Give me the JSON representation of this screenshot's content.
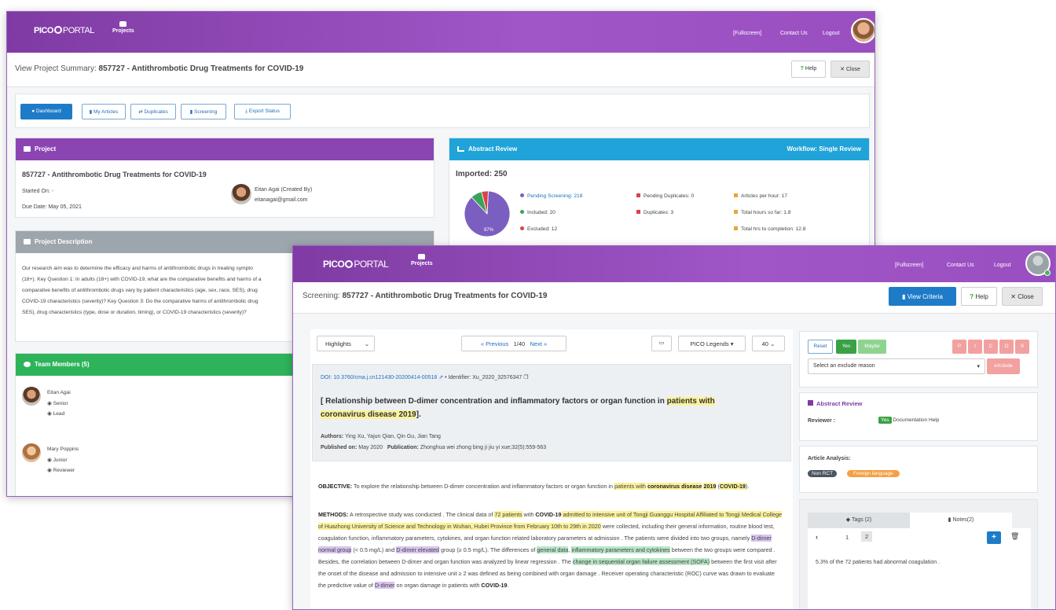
{
  "brand": {
    "logo_bold": "PICO",
    "logo_light": "PORTAL"
  },
  "navbar": {
    "projects": "Projects",
    "fullscreen": "[Fullscreen]",
    "contact": "Contact Us",
    "logout": "Logout"
  },
  "summary": {
    "title_prefix": "View Project Summary:",
    "title_main": "857727 - Antithrombotic Drug Treatments for COVID-19",
    "help": "Help",
    "close": "Close",
    "toolbar": {
      "dashboard": "Dashboard",
      "my_articles": "My Articles",
      "duplicates": "Duplicates",
      "screening": "Screening",
      "export_status": "Export Status"
    },
    "project": {
      "header": "Project",
      "title": "857727 - Antithrombotic Drug Treatments for COVID-19",
      "started_on": "Started On: -",
      "due_date": "Due Date:   May 05, 2021",
      "owner_name": "Eitan Agai (Created By)",
      "owner_email": "eitanagai@gmail.com"
    },
    "description": {
      "header": "Project Description",
      "lines": [
        "Our research aim was to determine the efficacy and harms of antithrombotic drugs in treating sympto",
        "(18+). Key Question 1: In adults (18+) with COVID-19, what are the comparative benefits and harms of a",
        "comparative benefits of antithrombotic drugs vary by patient characteristics (age, sex, race, SES), drug",
        "COVID-19 characteristics (severity)? Key Question 3: Do the comparative harms of antithrombotic drug",
        "SES), drug characteristics (type, dose or duration, timing), or COVID-19 characteristics (severity)?"
      ]
    },
    "team": {
      "header": "Team Members (5)",
      "members": [
        {
          "name": "Eitan Agai",
          "level": "Senior",
          "role": "Lead"
        },
        {
          "name": "Mary Poppins",
          "level": "Junior",
          "role": "Reviewer"
        }
      ]
    },
    "abstract_review": {
      "header": "Abstract Review",
      "workflow": "Workflow: Single Review",
      "imported": "Imported: 250",
      "pie_label": "87%",
      "pie_slices": [
        {
          "label": "Pending Screening",
          "value": 218,
          "color": "#7b5fc0"
        },
        {
          "label": "Included",
          "value": 20,
          "color": "#3aa35a"
        },
        {
          "label": "Excluded",
          "value": 12,
          "color": "#d9434a"
        }
      ],
      "col1": [
        {
          "text": "Pending Screening: 218",
          "color": "#7b5fc0"
        },
        {
          "text": "Included: 20",
          "color": "#3aa35a"
        },
        {
          "text": "Excluded: 12",
          "color": "#d9434a"
        }
      ],
      "col2": [
        {
          "text": "Pending Duplicates: 0",
          "color": "#d9434a"
        },
        {
          "text": "Duplicates: 3",
          "color": "#d9434a"
        }
      ],
      "col3": [
        {
          "text": "Articles per hour: 17",
          "color": "#f0a040"
        },
        {
          "text": "Total hours so far: 1.8",
          "color": "#f0a040"
        },
        {
          "text": "Total hrs to completion: 12.8",
          "color": "#f0a040"
        }
      ]
    }
  },
  "screening": {
    "title_prefix": "Screening:",
    "title_main": "857727 - Antithrombotic Drug Treatments for COVID-19",
    "view_criteria": "View Criteria",
    "help": "Help",
    "close": "Close",
    "highlights": "Highlights",
    "previous": "« Previous",
    "page": "1/40",
    "next": "Next »",
    "pico_legends": "PICO Legends",
    "page_size": "40",
    "doi": "DOI: 10.3760/cma.j.cn121430-20200414-00518",
    "identifier": "• Identifier: Xu_2020_32576347",
    "article_title_a": "[ Relationship between D-dimer concentration and inflammatory factors or organ function in ",
    "article_title_hl": "patients with",
    "article_title_b": "coronavirus disease 2019",
    "article_title_c": "].",
    "authors_label": "Authors:",
    "authors": "Ying Xu, Yajun Qian, Qin Gu, Jian Tang",
    "published_label": "Published on:",
    "published": "May 2020",
    "publication_label": "Publication:",
    "publication": "Zhonghua wei zhong bing ji jiu yi xue;32(5):559-563",
    "objective": {
      "label": "OBJECTIVE:",
      "t1": " To explore the relationship between D-dimer concentration and inflammatory factors or organ function in ",
      "h1": "patients with",
      "t2": " ",
      "h2": "coronavirus disease",
      "h3": "2019",
      "t3": " (",
      "h4": "COVID-19",
      "t4": ")."
    },
    "methods": {
      "label": "METHODS:",
      "t1": " A retrospective study was conducted . The clinical data of ",
      "h1": "72 patients",
      "t2": " with ",
      "h2": "COVID-19",
      "t3": " admitted to intensive unit of Tongji Guanggu Hospital Affiliated to Tongji Medical College of Huazhong University of Science and Technology in Wuhan, Hubei Province from February 10th to 29th in 2020",
      "t4": " were collected, including their general information, routine blood test, coagulation function, inflammatory parameters, cytokines, and organ function related laboratory parameters at admission . The patients were divided into two groups, namely ",
      "p1": "D-dimer normal group",
      "t5": " (< 0.5 mg/L) and ",
      "p2": "D-dimer elevated",
      "t6": " group (≥ 0.5 mg/L). The differences of ",
      "g1": "general data",
      "t7": ", ",
      "g2": "inflammatory parameters and cytokines",
      "t8": " between the two groups were compared . Besides, the correlation between D-dimer and organ function was analyzed by linear regression . The ",
      "g3": "change in sequential organ failure assessment (SOFA)",
      "t9": " between the first visit after the onset of the disease and admission to intensive unit ≥ 2 was defined as being combined with organ damage . Receiver operating characteristic (ROC) curve was drawn to evaluate the predictive value of ",
      "p3": "D-dimer",
      "t10": " on organ damage in patients with ",
      "h3": "COVID-19",
      "t11": "."
    },
    "side": {
      "reset": "Reset",
      "yes": "Yes",
      "maybe": "Maybe",
      "exclude_letters": [
        "P",
        "I",
        "C",
        "O",
        "S"
      ],
      "exclude_reason": "Select an exclude reason",
      "exclude_btn": "eXclude",
      "abstract_review": "Abstract Review",
      "reviewer_label": "Reviewer :",
      "reviewer_badge": "Yes",
      "reviewer_name": "Documentation Help",
      "analysis_label": "Article Analysis:",
      "badge_nonrct": "Non RCT",
      "badge_foreign": "Foreign language",
      "tab_tags": "Tags (2)",
      "tab_notes": "Notes(2)",
      "pager_prev": "‹",
      "pager_1": "1",
      "pager_2": "2",
      "note": "5.3% of the 72 patients had abnormal coagulation ."
    }
  },
  "colors": {
    "purple": "#8a45b3",
    "blue": "#1fa3d8",
    "green": "#2fb35a",
    "gray": "#9ea6ad"
  }
}
